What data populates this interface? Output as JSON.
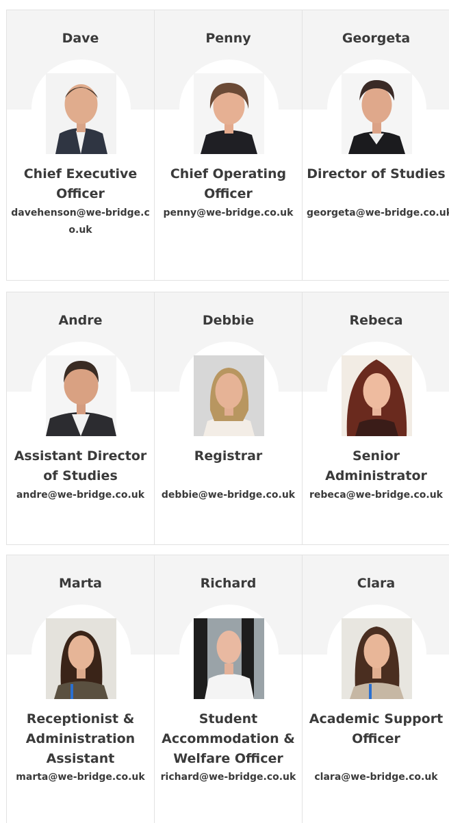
{
  "team": [
    {
      "name": "Dave",
      "title": "Chief Executive Officer",
      "email": "davehenson@we-bridge.co.uk"
    },
    {
      "name": "Penny",
      "title": "Chief Operating Officer",
      "email": "penny@we-bridge.co.uk"
    },
    {
      "name": "Georgeta",
      "title": "Director of Studies",
      "email": "georgeta@we-bridge.co.uk"
    },
    {
      "name": "Andre",
      "title": "Assistant Director of Studies",
      "email": "andre@we-bridge.co.uk"
    },
    {
      "name": "Debbie",
      "title": "Registrar",
      "email": "debbie@we-bridge.co.uk"
    },
    {
      "name": "Rebeca",
      "title": "Senior Administrator",
      "email": "rebeca@we-bridge.co.uk"
    },
    {
      "name": "Marta",
      "title": "Receptionist & Administration Assistant",
      "email": "marta@we-bridge.co.uk"
    },
    {
      "name": "Richard",
      "title": "Student Accommodation & Welfare Officer",
      "email": "richard@we-bridge.co.uk"
    },
    {
      "name": "Clara",
      "title": "Academic Support Officer",
      "email": "clara@we-bridge.co.uk"
    }
  ],
  "colors": {
    "band": "#f4f4f4",
    "text": "#3a3a3a",
    "border": "#e2e2e2"
  }
}
